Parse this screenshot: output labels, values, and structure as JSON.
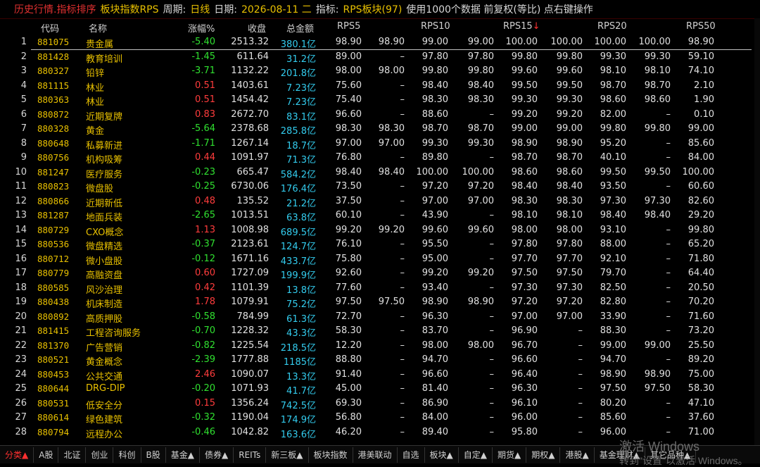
{
  "topbar": {
    "app": "历史行情.指标排序",
    "board_label": "板块指数RPS",
    "period_label": "周期:",
    "period_value": "日线",
    "date_label": "日期:",
    "date_value": "2026-08-11 二",
    "indicator_label": "指标:",
    "indicator_value": "RPS板块(97)",
    "note": "使用1000个数据 前复权(等比) 点右键操作"
  },
  "headers": {
    "code": "代码",
    "name": "名称",
    "pct": "涨幅%",
    "close": "收盘",
    "amount": "总金额",
    "rps5": "RPS5",
    "rps10": "RPS10",
    "rps15": "RPS15",
    "rps15_arrow": "↓",
    "rps20": "RPS20",
    "rps50": "RPS50"
  },
  "rows": [
    {
      "i": "1",
      "code": "881075",
      "name": "贵金属",
      "pct": "-5.40",
      "close": "2513.32",
      "amt": "380.1亿",
      "v": [
        "98.90",
        "98.90",
        "99.00",
        "99.00",
        "100.00",
        "100.00",
        "100.00",
        "100.00",
        "98.90"
      ]
    },
    {
      "i": "2",
      "code": "881428",
      "name": "教育培训",
      "pct": "-1.45",
      "close": "611.64",
      "amt": "31.2亿",
      "v": [
        "89.00",
        "–",
        "97.80",
        "97.80",
        "99.80",
        "99.80",
        "99.30",
        "99.30",
        "59.10"
      ]
    },
    {
      "i": "3",
      "code": "880327",
      "name": "铅锌",
      "pct": "-3.71",
      "close": "1132.22",
      "amt": "201.8亿",
      "v": [
        "98.00",
        "98.00",
        "99.80",
        "99.80",
        "99.60",
        "99.60",
        "98.10",
        "98.10",
        "74.10"
      ]
    },
    {
      "i": "4",
      "code": "881115",
      "name": "林业",
      "pct": "0.51",
      "close": "1403.61",
      "amt": "7.23亿",
      "v": [
        "75.60",
        "–",
        "98.40",
        "98.40",
        "99.50",
        "99.50",
        "98.70",
        "98.70",
        "2.10"
      ]
    },
    {
      "i": "5",
      "code": "880363",
      "name": "林业",
      "pct": "0.51",
      "close": "1454.42",
      "amt": "7.23亿",
      "v": [
        "75.40",
        "–",
        "98.30",
        "98.30",
        "99.30",
        "99.30",
        "98.60",
        "98.60",
        "1.90"
      ]
    },
    {
      "i": "6",
      "code": "880872",
      "name": "近期复牌",
      "pct": "0.83",
      "close": "2672.70",
      "amt": "83.1亿",
      "v": [
        "96.60",
        "–",
        "88.60",
        "–",
        "99.20",
        "99.20",
        "82.00",
        "–",
        "0.10"
      ]
    },
    {
      "i": "7",
      "code": "880328",
      "name": "黄金",
      "pct": "-5.64",
      "close": "2378.68",
      "amt": "285.8亿",
      "v": [
        "98.30",
        "98.30",
        "98.70",
        "98.70",
        "99.00",
        "99.00",
        "99.80",
        "99.80",
        "99.00"
      ]
    },
    {
      "i": "8",
      "code": "880648",
      "name": "私募新进",
      "pct": "-1.71",
      "close": "1267.14",
      "amt": "18.7亿",
      "v": [
        "97.00",
        "97.00",
        "99.30",
        "99.30",
        "98.90",
        "98.90",
        "95.20",
        "–",
        "85.60"
      ]
    },
    {
      "i": "9",
      "code": "880756",
      "name": "机构吸筹",
      "pct": "0.44",
      "close": "1091.97",
      "amt": "71.3亿",
      "v": [
        "76.80",
        "–",
        "89.80",
        "–",
        "98.70",
        "98.70",
        "40.10",
        "–",
        "84.00"
      ]
    },
    {
      "i": "10",
      "code": "881247",
      "name": "医疗服务",
      "pct": "-0.23",
      "close": "665.47",
      "amt": "584.2亿",
      "v": [
        "98.40",
        "98.40",
        "100.00",
        "100.00",
        "98.60",
        "98.60",
        "99.50",
        "99.50",
        "100.00"
      ]
    },
    {
      "i": "11",
      "code": "880823",
      "name": "微盘股",
      "pct": "-0.25",
      "close": "6730.06",
      "amt": "176.4亿",
      "v": [
        "73.50",
        "–",
        "97.20",
        "97.20",
        "98.40",
        "98.40",
        "93.50",
        "–",
        "60.60"
      ]
    },
    {
      "i": "12",
      "code": "880866",
      "name": "近期新低",
      "pct": "0.48",
      "close": "135.52",
      "amt": "21.2亿",
      "v": [
        "37.50",
        "–",
        "97.00",
        "97.00",
        "98.30",
        "98.30",
        "97.30",
        "97.30",
        "82.60"
      ]
    },
    {
      "i": "13",
      "code": "881287",
      "name": "地面兵装",
      "pct": "-2.65",
      "close": "1013.51",
      "amt": "63.8亿",
      "v": [
        "60.10",
        "–",
        "43.90",
        "–",
        "98.10",
        "98.10",
        "98.40",
        "98.40",
        "29.20"
      ]
    },
    {
      "i": "14",
      "code": "880729",
      "name": "CXO概念",
      "pct": "1.13",
      "close": "1008.98",
      "amt": "689.5亿",
      "v": [
        "99.20",
        "99.20",
        "99.60",
        "99.60",
        "98.00",
        "98.00",
        "93.10",
        "–",
        "99.80"
      ]
    },
    {
      "i": "15",
      "code": "880536",
      "name": "微盘精选",
      "pct": "-0.37",
      "close": "2123.61",
      "amt": "124.7亿",
      "v": [
        "76.10",
        "–",
        "95.50",
        "–",
        "97.80",
        "97.80",
        "88.00",
        "–",
        "65.20"
      ]
    },
    {
      "i": "16",
      "code": "880712",
      "name": "微小盘股",
      "pct": "-0.12",
      "close": "1671.16",
      "amt": "433.7亿",
      "v": [
        "75.80",
        "–",
        "95.00",
        "–",
        "97.70",
        "97.70",
        "92.10",
        "–",
        "71.80"
      ]
    },
    {
      "i": "17",
      "code": "880779",
      "name": "高融资盘",
      "pct": "0.60",
      "close": "1727.09",
      "amt": "199.9亿",
      "v": [
        "92.60",
        "–",
        "99.20",
        "99.20",
        "97.50",
        "97.50",
        "79.70",
        "–",
        "64.40"
      ]
    },
    {
      "i": "18",
      "code": "880585",
      "name": "风沙治理",
      "pct": "0.42",
      "close": "1101.39",
      "amt": "13.8亿",
      "v": [
        "77.60",
        "–",
        "93.40",
        "–",
        "97.30",
        "97.30",
        "82.50",
        "–",
        "20.50"
      ]
    },
    {
      "i": "19",
      "code": "880438",
      "name": "机床制造",
      "pct": "1.78",
      "close": "1079.91",
      "amt": "75.2亿",
      "v": [
        "97.50",
        "97.50",
        "98.90",
        "98.90",
        "97.20",
        "97.20",
        "82.80",
        "–",
        "70.20"
      ]
    },
    {
      "i": "20",
      "code": "880892",
      "name": "高质押股",
      "pct": "-0.58",
      "close": "784.99",
      "amt": "61.3亿",
      "v": [
        "72.70",
        "–",
        "96.30",
        "–",
        "97.00",
        "97.00",
        "33.90",
        "–",
        "71.60"
      ]
    },
    {
      "i": "21",
      "code": "881415",
      "name": "工程咨询服务",
      "pct": "-0.70",
      "close": "1228.32",
      "amt": "43.3亿",
      "v": [
        "58.30",
        "–",
        "83.70",
        "–",
        "96.90",
        "–",
        "88.30",
        "–",
        "73.20"
      ]
    },
    {
      "i": "22",
      "code": "881370",
      "name": "广告营销",
      "pct": "-0.82",
      "close": "1225.54",
      "amt": "218.5亿",
      "v": [
        "12.20",
        "–",
        "98.00",
        "98.00",
        "96.70",
        "–",
        "99.00",
        "99.00",
        "25.50"
      ]
    },
    {
      "i": "23",
      "code": "880521",
      "name": "黄金概念",
      "pct": "-2.39",
      "close": "1777.88",
      "amt": "1185亿",
      "v": [
        "88.80",
        "–",
        "94.70",
        "–",
        "96.60",
        "–",
        "94.70",
        "–",
        "89.20"
      ]
    },
    {
      "i": "24",
      "code": "880453",
      "name": "公共交通",
      "pct": "2.46",
      "close": "1090.07",
      "amt": "13.3亿",
      "v": [
        "91.40",
        "–",
        "96.60",
        "–",
        "96.40",
        "–",
        "98.90",
        "98.90",
        "75.00"
      ]
    },
    {
      "i": "25",
      "code": "880644",
      "name": "DRG-DIP",
      "pct": "-0.20",
      "close": "1071.93",
      "amt": "41.7亿",
      "v": [
        "45.00",
        "–",
        "81.40",
        "–",
        "96.30",
        "–",
        "97.50",
        "97.50",
        "58.30"
      ]
    },
    {
      "i": "26",
      "code": "880531",
      "name": "低安全分",
      "pct": "0.15",
      "close": "1356.24",
      "amt": "742.5亿",
      "v": [
        "69.30",
        "–",
        "86.90",
        "–",
        "96.10",
        "–",
        "80.20",
        "–",
        "47.10"
      ]
    },
    {
      "i": "27",
      "code": "880614",
      "name": "绿色建筑",
      "pct": "-0.32",
      "close": "1190.04",
      "amt": "174.9亿",
      "v": [
        "56.80",
        "–",
        "84.00",
        "–",
        "96.00",
        "–",
        "85.60",
        "–",
        "37.60"
      ]
    },
    {
      "i": "28",
      "code": "880794",
      "name": "远程办公",
      "pct": "-0.46",
      "close": "1042.82",
      "amt": "163.6亿",
      "v": [
        "46.20",
        "–",
        "89.40",
        "–",
        "95.80",
        "–",
        "96.00",
        "–",
        "71.00"
      ]
    }
  ],
  "bottom_tabs": [
    "分类▲",
    "A股",
    "北证",
    "创业",
    "科创",
    "B股",
    "基金▲",
    "债券▲",
    "REITs",
    "新三板▲",
    "板块指数",
    "港美联动",
    "自选",
    "板块▲",
    "自定▲",
    "期货▲",
    "期权▲",
    "港股▲",
    "基金理财▲",
    "其它品种▲"
  ],
  "watermark": {
    "line1": "激活 Windows",
    "line2": "转到\"设置\"以激活 Windows。"
  }
}
